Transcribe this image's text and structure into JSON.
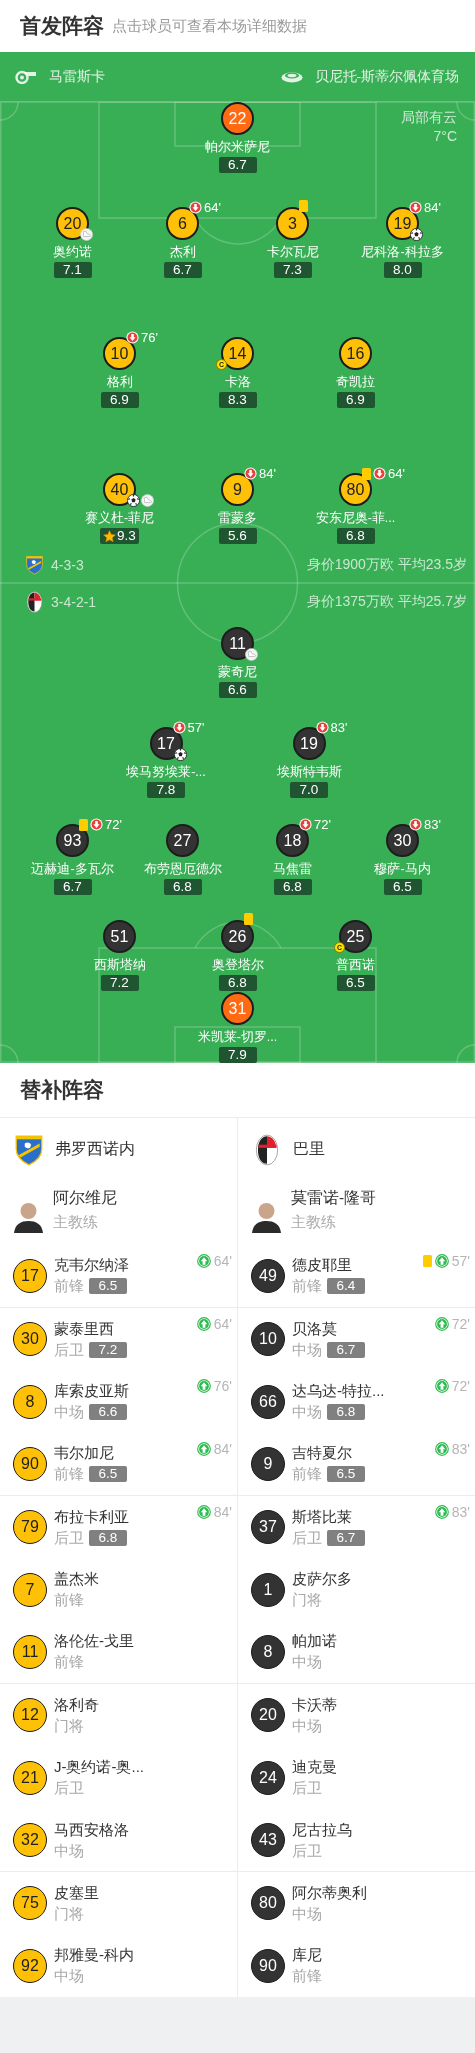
{
  "lineup_header": {
    "title": "首发阵容",
    "hint": "点击球员可查看本场详细数据"
  },
  "match_info": {
    "referee": "马雷斯卡",
    "stadium": "贝尼托-斯蒂尔佩体育场",
    "weather": "局部有云",
    "temperature": "7°C"
  },
  "teams": [
    {
      "name": "弗罗西诺内",
      "color": "#ffc107",
      "formation": "4-3-3",
      "summary": "身价1900万欧 平均23.5岁",
      "coach": "阿尔维尼",
      "coach_role": "主教练",
      "lines": [
        [
          {
            "number": "22",
            "name": "帕尔米萨尼",
            "rating": "6.7",
            "kind": "goalkeeper"
          }
        ],
        [
          {
            "number": "20",
            "name": "奥约诺",
            "rating": "7.1",
            "kind": "outfield",
            "badges": [
              {
                "kind": "assist"
              }
            ]
          },
          {
            "number": "6",
            "name": "杰利",
            "rating": "6.7",
            "kind": "outfield",
            "badges": [
              {
                "kind": "sub_off",
                "minute": "64'"
              }
            ]
          },
          {
            "number": "3",
            "name": "卡尔瓦尼",
            "rating": "7.3",
            "kind": "outfield",
            "badges": [
              {
                "kind": "yellow_card"
              }
            ]
          },
          {
            "number": "19",
            "name": "尼科洛-科拉多",
            "rating": "8.0",
            "kind": "outfield",
            "badges": [
              {
                "kind": "sub_off",
                "minute": "84'"
              },
              {
                "kind": "goal"
              }
            ]
          }
        ],
        [
          {
            "number": "10",
            "name": "格利",
            "rating": "6.9",
            "kind": "outfield",
            "badges": [
              {
                "kind": "sub_off",
                "minute": "76'"
              }
            ]
          },
          {
            "number": "14",
            "name": "卡洛",
            "rating": "8.3",
            "kind": "outfield",
            "badges": [
              {
                "kind": "captain",
                "label": "C"
              }
            ]
          },
          {
            "number": "16",
            "name": "奇凯拉",
            "rating": "6.9",
            "kind": "outfield"
          }
        ],
        [
          {
            "number": "40",
            "name": "赛义杜-菲尼",
            "rating": "9.3",
            "kind": "outfield",
            "badges": [
              {
                "kind": "goal"
              },
              {
                "kind": "assist"
              },
              {
                "kind": "top_rated"
              }
            ]
          },
          {
            "number": "9",
            "name": "雷蒙多",
            "rating": "5.6",
            "kind": "outfield",
            "badges": [
              {
                "kind": "sub_off",
                "minute": "84'"
              }
            ]
          },
          {
            "number": "80",
            "name": "安东尼奥-菲...",
            "rating": "6.8",
            "kind": "outfield",
            "badges": [
              {
                "kind": "yellow_card"
              },
              {
                "kind": "sub_off",
                "minute": "64'"
              }
            ]
          }
        ]
      ],
      "substitutes": [
        {
          "number": "17",
          "name": "克韦尔纳泽",
          "position": "前锋",
          "rating": "6.5",
          "badges": [
            {
              "kind": "sub_on",
              "minute": "64'"
            }
          ]
        },
        {
          "number": "30",
          "name": "蒙泰里西",
          "position": "后卫",
          "rating": "7.2",
          "badges": [
            {
              "kind": "sub_on",
              "minute": "64'"
            }
          ]
        },
        {
          "number": "8",
          "name": "库索皮亚斯",
          "position": "中场",
          "rating": "6.6",
          "badges": [
            {
              "kind": "sub_on",
              "minute": "76'"
            }
          ]
        },
        {
          "number": "90",
          "name": "韦尔加尼",
          "position": "前锋",
          "rating": "6.5",
          "badges": [
            {
              "kind": "sub_on",
              "minute": "84'"
            }
          ]
        },
        {
          "number": "79",
          "name": "布拉卡利亚",
          "position": "后卫",
          "rating": "6.8",
          "badges": [
            {
              "kind": "sub_on",
              "minute": "84'"
            }
          ]
        },
        {
          "number": "7",
          "name": "盖杰米",
          "position": "前锋"
        },
        {
          "number": "11",
          "name": "洛伦佐-戈里",
          "position": "前锋"
        },
        {
          "number": "12",
          "name": "洛利奇",
          "position": "门将"
        },
        {
          "number": "21",
          "name": "J-奥约诺-奥...",
          "position": "后卫"
        },
        {
          "number": "32",
          "name": "马西安格洛",
          "position": "中场"
        },
        {
          "number": "75",
          "name": "皮塞里",
          "position": "门将"
        },
        {
          "number": "92",
          "name": "邦雅曼-科内",
          "position": "中场"
        }
      ]
    },
    {
      "name": "巴里",
      "color": "#333333",
      "formation": "3-4-2-1",
      "summary": "身价1375万欧 平均25.7岁",
      "coach": "莫雷诺-隆哥",
      "coach_role": "主教练",
      "lines": [
        [
          {
            "number": "11",
            "name": "蒙奇尼",
            "rating": "6.6",
            "kind": "outfield",
            "badges": [
              {
                "kind": "assist"
              }
            ]
          }
        ],
        [
          {
            "number": "17",
            "name": "埃马努埃莱-...",
            "rating": "7.8",
            "kind": "outfield",
            "badges": [
              {
                "kind": "sub_off",
                "minute": "57'"
              },
              {
                "kind": "goal"
              }
            ]
          },
          {
            "number": "19",
            "name": "埃斯特韦斯",
            "rating": "7.0",
            "kind": "outfield",
            "badges": [
              {
                "kind": "sub_off",
                "minute": "83'"
              }
            ]
          }
        ],
        [
          {
            "number": "93",
            "name": "迈赫迪-多瓦尔",
            "rating": "6.7",
            "kind": "outfield",
            "badges": [
              {
                "kind": "yellow_card"
              },
              {
                "kind": "sub_off",
                "minute": "72'"
              }
            ]
          },
          {
            "number": "27",
            "name": "布劳恩厄德尔",
            "rating": "6.8",
            "kind": "outfield"
          },
          {
            "number": "18",
            "name": "马焦雷",
            "rating": "6.8",
            "kind": "outfield",
            "badges": [
              {
                "kind": "sub_off",
                "minute": "72'"
              }
            ]
          },
          {
            "number": "30",
            "name": "穆萨-马内",
            "rating": "6.5",
            "kind": "outfield",
            "badges": [
              {
                "kind": "sub_off",
                "minute": "83'"
              }
            ]
          }
        ],
        [
          {
            "number": "51",
            "name": "西斯塔纳",
            "rating": "7.2",
            "kind": "outfield"
          },
          {
            "number": "26",
            "name": "奥登塔尔",
            "rating": "6.8",
            "kind": "outfield",
            "badges": [
              {
                "kind": "yellow_card"
              }
            ]
          },
          {
            "number": "25",
            "name": "普西诺",
            "rating": "6.5",
            "kind": "outfield",
            "badges": [
              {
                "kind": "captain",
                "label": "C"
              }
            ]
          }
        ],
        [
          {
            "number": "31",
            "name": "米凯莱-切罗...",
            "rating": "7.9",
            "kind": "goalkeeper"
          }
        ]
      ],
      "substitutes": [
        {
          "number": "49",
          "name": "德皮耶里",
          "position": "前锋",
          "rating": "6.4",
          "badges": [
            {
              "kind": "yellow_card"
            },
            {
              "kind": "sub_on",
              "minute": "57'"
            }
          ]
        },
        {
          "number": "10",
          "name": "贝洛莫",
          "position": "中场",
          "rating": "6.7",
          "badges": [
            {
              "kind": "sub_on",
              "minute": "72'"
            }
          ]
        },
        {
          "number": "66",
          "name": "达乌达-特拉...",
          "position": "中场",
          "rating": "6.8",
          "badges": [
            {
              "kind": "sub_on",
              "minute": "72'"
            }
          ]
        },
        {
          "number": "9",
          "name": "吉特夏尔",
          "position": "前锋",
          "rating": "6.5",
          "badges": [
            {
              "kind": "sub_on",
              "minute": "83'"
            }
          ]
        },
        {
          "number": "37",
          "name": "斯塔比莱",
          "position": "后卫",
          "rating": "6.7",
          "badges": [
            {
              "kind": "sub_on",
              "minute": "83'"
            }
          ]
        },
        {
          "number": "1",
          "name": "皮萨尔多",
          "position": "门将"
        },
        {
          "number": "8",
          "name": "帕加诺",
          "position": "中场"
        },
        {
          "number": "20",
          "name": "卡沃蒂",
          "position": "中场"
        },
        {
          "number": "24",
          "name": "迪克曼",
          "position": "后卫"
        },
        {
          "number": "43",
          "name": "尼古拉乌",
          "position": "后卫"
        },
        {
          "number": "80",
          "name": "阿尔蒂奥利",
          "position": "中场"
        },
        {
          "number": "90",
          "name": "库尼",
          "position": "前锋"
        }
      ]
    }
  ],
  "subs_header": {
    "title": "替补阵容"
  }
}
